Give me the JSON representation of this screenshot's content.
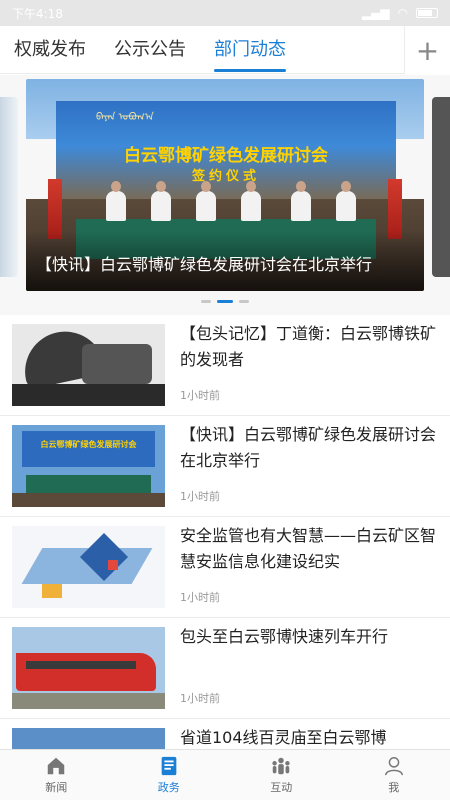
{
  "status_bar": {
    "time": "下午4:18"
  },
  "tabs": [
    {
      "label": "权威发布",
      "active": false
    },
    {
      "label": "公示公告",
      "active": false
    },
    {
      "label": "部门动态",
      "active": true
    }
  ],
  "add_tab_label": "+",
  "banner": {
    "mongolian_text": "ᠪᠠᠶᠠᠨ ᠣᠪᠣᠭ᠎ᠠ",
    "backdrop_title": "白云鄂博矿绿色发展研讨会",
    "backdrop_subtitle": "签约仪式",
    "caption": "【快讯】白云鄂博矿绿色发展研讨会在北京举行",
    "dots": 3,
    "active_dot": 1
  },
  "news": [
    {
      "title": "【包头记忆】丁道衡：白云鄂博铁矿的发现者",
      "time": "1小时前"
    },
    {
      "title": "【快讯】白云鄂博矿绿色发展研讨会在北京举行",
      "time": "1小时前"
    },
    {
      "title": "安全监管也有大智慧——白云矿区智慧安监信息化建设纪实",
      "time": "1小时前"
    },
    {
      "title": "包头至白云鄂博快速列车开行",
      "time": "1小时前"
    },
    {
      "title": "省道104线百灵庙至白云鄂博",
      "time": ""
    }
  ],
  "news_thumb_text": "白云鄂博矿绿色发展研讨会",
  "bottom_nav": [
    {
      "label": "新闻",
      "icon": "home-icon",
      "active": false
    },
    {
      "label": "政务",
      "icon": "document-icon",
      "active": true
    },
    {
      "label": "互动",
      "icon": "people-icon",
      "active": false
    },
    {
      "label": "我",
      "icon": "user-icon",
      "active": false
    }
  ],
  "colors": {
    "accent": "#1b7fd6",
    "text": "#222222",
    "muted": "#999999"
  }
}
